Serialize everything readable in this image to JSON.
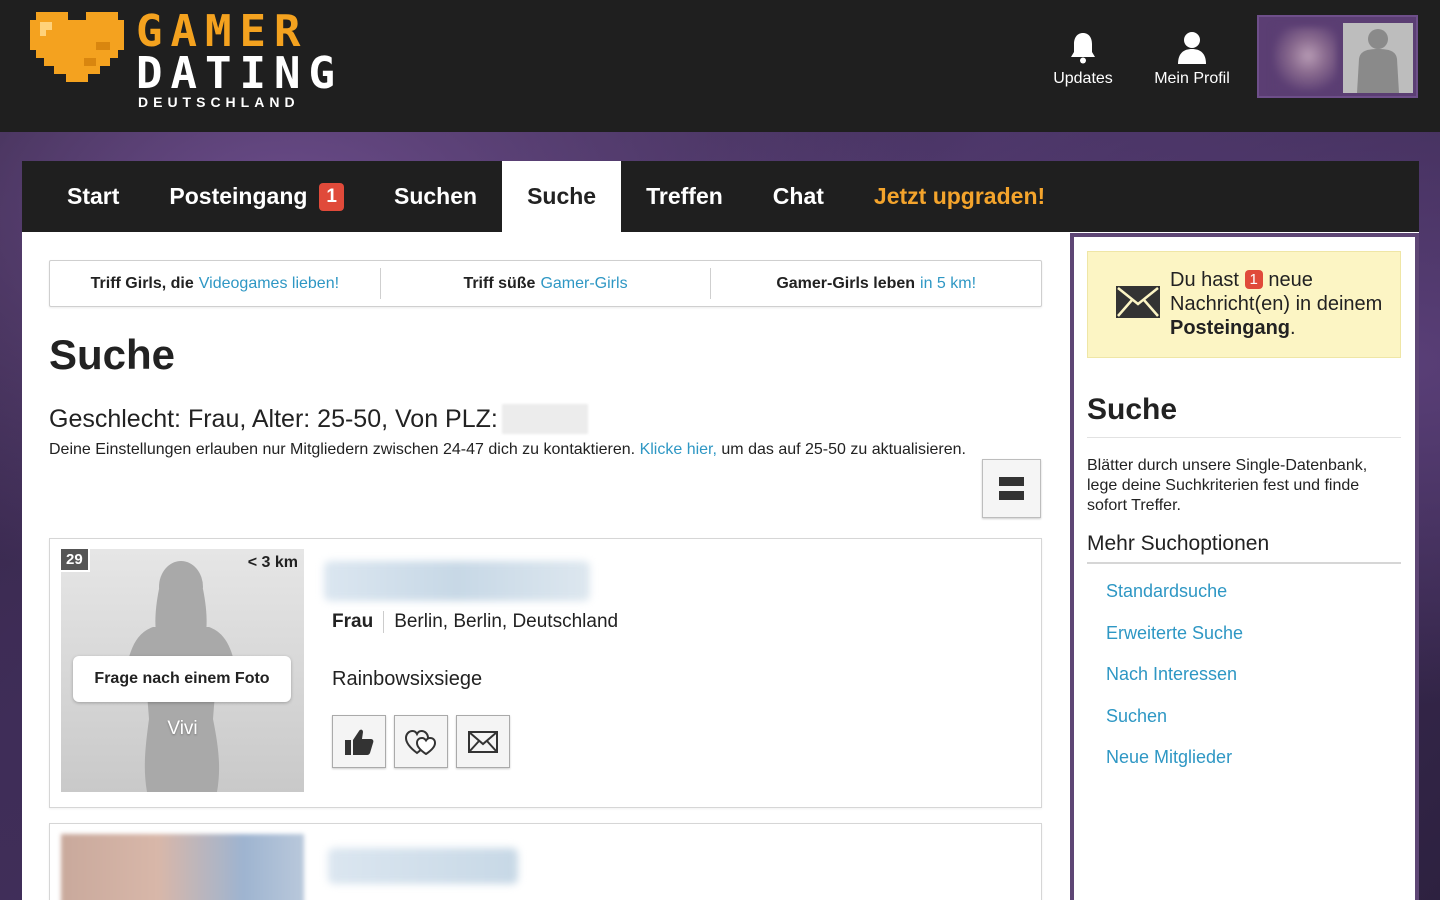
{
  "header": {
    "logo": {
      "line1": "GAMER",
      "line2": "DATING",
      "line3": "DEUTSCHLAND"
    },
    "nav": [
      {
        "label": "Updates",
        "icon": "bell-icon"
      },
      {
        "label": "Mein Profil",
        "icon": "user-icon"
      }
    ]
  },
  "main_nav": {
    "tabs": [
      {
        "label": "Start"
      },
      {
        "label": "Posteingang",
        "badge": "1"
      },
      {
        "label": "Suchen"
      },
      {
        "label": "Suche",
        "active": true
      },
      {
        "label": "Treffen"
      },
      {
        "label": "Chat"
      },
      {
        "label": "Jetzt upgraden!"
      }
    ]
  },
  "promo": [
    {
      "text": "Triff Girls, die",
      "link": "Videogames lieben!"
    },
    {
      "text": "Triff süße",
      "link": "Gamer-Girls"
    },
    {
      "text": "Gamer-Girls leben",
      "link": "in 5 km!"
    }
  ],
  "content": {
    "title": "Suche",
    "criteria": "Geschlecht: Frau, Alter: 25-50, Von PLZ:",
    "note": {
      "before": "Deine Einstellungen erlauben nur Mitgliedern zwischen 24-47 dich zu kontaktieren.",
      "link": "Klicke hier,",
      "after": "um das auf 25-50 zu aktualisieren."
    }
  },
  "results": [
    {
      "age": "29",
      "distance": "< 3 km",
      "ask_photo": "Frage nach einem Foto",
      "name": "Vivi",
      "gender": "Frau",
      "location": "Berlin, Berlin, Deutschland",
      "interest": "Rainbowsixsiege",
      "actions": [
        "thumbs-up-icon",
        "hearts-icon",
        "envelope-icon"
      ]
    }
  ],
  "sidebar": {
    "notice": {
      "pre": "Du hast",
      "count": "1",
      "mid": "neue Nachricht(en) in deinem",
      "strong": "Posteingang",
      "end": "."
    },
    "title": "Suche",
    "description": "Blätter durch unsere Single-Datenbank, lege deine Suchkriterien fest und finde sofort Treffer.",
    "subtitle": "Mehr Suchoptionen",
    "links": [
      "Standardsuche",
      "Erweiterte Suche",
      "Nach Interessen",
      "Suchen",
      "Neue Mitglieder"
    ]
  },
  "colors": {
    "accent_orange": "#f4a42c",
    "link_blue": "#2e97c4",
    "badge_red": "#e04a3a",
    "sidebar_border": "#5e4675"
  }
}
